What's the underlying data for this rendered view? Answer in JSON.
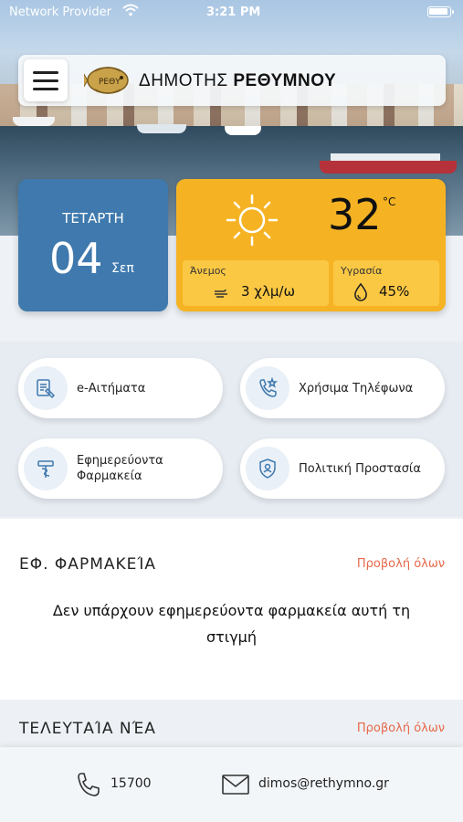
{
  "status_bar": {
    "carrier": "Network Provider",
    "time": "3:21 PM"
  },
  "header": {
    "title_prefix": "ΔΗΜΟΤΗΣ",
    "title_city": "ΡΕΘΥΜΝΟΥ",
    "logo_icon": "fish-crest-logo-icon",
    "logo_text": "ΡΕΘΥ"
  },
  "date_card": {
    "weekday": "ΤΕΤΑΡΤΗ",
    "day": "04",
    "month": "Σεπ",
    "color": "#3f79ad"
  },
  "weather": {
    "temperature": "32",
    "unit": "°C",
    "wind_label": "Άνεμος",
    "wind_value": "3 χλμ/ω",
    "humidity_label": "Υγρασία",
    "humidity_value": "45%",
    "icon": "sun-icon",
    "color": "#f5b323"
  },
  "quick_actions": [
    {
      "label": "e-Αιτήματα",
      "icon": "document-request-icon"
    },
    {
      "label": "Χρήσιμα Τηλέφωνα",
      "icon": "phone-star-icon"
    },
    {
      "label": "Εφημερεύοντα\nΦαρμακεία",
      "icon": "pharmacy-icon"
    },
    {
      "label": "Πολιτική Προστασία",
      "icon": "shield-person-icon"
    }
  ],
  "pharmacies": {
    "title": "ΕΦ. ΦΑΡΜΑΚΕΊΑ",
    "view_all": "Προβολή όλων",
    "empty_message": "Δεν υπάρχουν εφημερεύοντα φαρμακεία αυτή τη στιγμή"
  },
  "news": {
    "title": "ΤΕΛΕΥΤΑΊΑ ΝΈΑ",
    "view_all": "Προβολή όλων"
  },
  "footer": {
    "phone": "15700",
    "email": "dimos@rethymno.gr"
  },
  "accent_color": "#e8684a"
}
